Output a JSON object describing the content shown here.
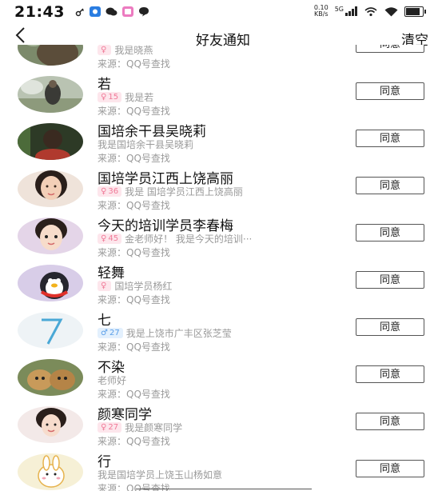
{
  "status": {
    "time": "21:43",
    "netspeed_value": "0.10",
    "netspeed_unit": "KB/s",
    "network": "5G"
  },
  "nav": {
    "title": "好友通知",
    "action": "清空"
  },
  "requests": [
    {
      "name": "",
      "message": "我是晓燕",
      "source": "来源：QQ号查找",
      "button": "同意",
      "avatar": "a0",
      "badge": {
        "gender": "female",
        "age": ""
      }
    },
    {
      "name": "若",
      "message": "我是若",
      "source": "来源：QQ号查找",
      "button": "同意",
      "avatar": "a1",
      "badge": {
        "gender": "female",
        "age": "15"
      }
    },
    {
      "name": "国培余干县吴晓莉",
      "message": "我是国培余干县吴晓莉",
      "source": "来源：QQ号查找",
      "button": "同意",
      "avatar": "a2",
      "badge": null
    },
    {
      "name": "国培学员江西上饶高丽",
      "message": "我是 国培学员江西上饶高丽",
      "source": "来源：QQ号查找",
      "button": "同意",
      "avatar": "a3",
      "badge": {
        "gender": "female",
        "age": "36"
      }
    },
    {
      "name": "今天的培训学员李春梅",
      "message": "金老师好！ 我是今天的培训···",
      "source": "来源：QQ号查找",
      "button": "同意",
      "avatar": "a4",
      "badge": {
        "gender": "female",
        "age": "45"
      }
    },
    {
      "name": "轻舞",
      "message": "国培学员杨红",
      "source": "来源：QQ号查找",
      "button": "同意",
      "avatar": "a5",
      "badge": {
        "gender": "female",
        "age": ""
      }
    },
    {
      "name": "七",
      "message": "我是上饶市广丰区张芝莹",
      "source": "来源：QQ号查找",
      "button": "同意",
      "avatar": "a6",
      "badge": {
        "gender": "male",
        "age": "27"
      }
    },
    {
      "name": "不染",
      "message": "老师好",
      "source": "来源：QQ号查找",
      "button": "同意",
      "avatar": "a7",
      "badge": null
    },
    {
      "name": "颜寒同学",
      "message": "我是颜寒同学",
      "source": "来源：QQ号查找",
      "button": "同意",
      "avatar": "a8",
      "badge": {
        "gender": "female",
        "age": "27"
      }
    },
    {
      "name": "行",
      "message": "我是国培学员上饶玉山杨如意",
      "source": "来源：QQ号查找",
      "button": "同意",
      "avatar": "a9",
      "badge": null
    }
  ],
  "colors": {
    "female_badge": "#f07a98",
    "male_badge": "#5a9ee8",
    "secondary_text": "#9a9a9a"
  }
}
